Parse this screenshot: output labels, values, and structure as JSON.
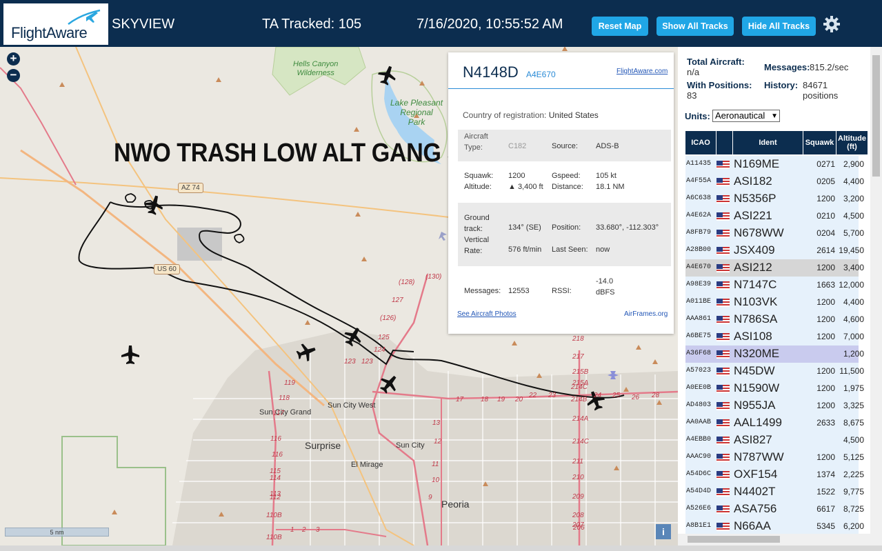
{
  "header": {
    "logo_text": "FlightAware",
    "app_title": "SKYVIEW",
    "tracked": "TA Tracked: 105",
    "datetime": "7/16/2020, 10:55:52 AM",
    "buttons": {
      "reset_map": "Reset Map",
      "show_all_tracks": "Show All Tracks",
      "hide_all_tracks": "Hide All Tracks"
    },
    "icons": {
      "settings": "gear-icon",
      "logo": "plane-logo-icon"
    }
  },
  "map": {
    "zoom_in": "+",
    "zoom_out": "−",
    "overlay_text": "NWO TRASH LOW ALT GANG STALKING",
    "scale_label": "5 nm",
    "info_label": "i",
    "places": {
      "hells_canyon": "Hells Canyon\nWilderness",
      "lake_pleasant": "Lake Pleasant\nRegional\nPark",
      "sun_city_grand": "Sun City Grand",
      "sun_city_west": "Sun City West",
      "surprise": "Surprise",
      "sun_city": "Sun City",
      "el_mirage": "El Mirage",
      "peoria": "Peoria"
    },
    "shields": {
      "az74": "AZ 74",
      "us60": "US 60"
    },
    "route_numbers": [
      "(128)",
      "(130)",
      "127",
      "(126)",
      "125",
      "124",
      "123",
      "123",
      "119",
      "118",
      "117",
      "116",
      "116",
      "115",
      "114",
      "113",
      "112",
      "110B",
      "110B",
      "1",
      "2",
      "3",
      "9",
      "10",
      "11",
      "12",
      "13",
      "17",
      "18",
      "19",
      "20",
      "22",
      "23",
      "24",
      "25",
      "26",
      "28",
      "218",
      "217",
      "215B",
      "215A",
      "214C",
      "214B",
      "214A",
      "214C",
      "211",
      "210",
      "209",
      "208",
      "207",
      "206"
    ]
  },
  "popup": {
    "callsign": "N4148D",
    "hex": "A4E670",
    "link": "FlightAware.com",
    "country_label": "Country of registration:",
    "country": "United States",
    "aircraft_type_label": "Aircraft\nType:",
    "aircraft_type_value": "C182",
    "source_label": "Source:",
    "source": "ADS-B",
    "squawk_label": "Squawk:",
    "squawk": "1200",
    "altitude_label": "Altitude:",
    "altitude": "▲ 3,400 ft",
    "gspeed_label": "Gspeed:",
    "gspeed": "105 kt",
    "distance_label": "Distance:",
    "distance": "18.1 NM",
    "ground_track_label": "Ground\ntrack:",
    "ground_track": "134° (SE)",
    "position_label": "Position:",
    "position": "33.680°, -112.303°",
    "vertical_rate_label": "Vertical\nRate:",
    "vertical_rate": "576 ft/min",
    "last_seen_label": "Last Seen:",
    "last_seen": "now",
    "messages_label": "Messages:",
    "messages": "12553",
    "rssi_label": "RSSI:",
    "rssi": "-14.0\ndBFS",
    "photos_link": "See Aircraft Photos",
    "airframes_link": "AirFrames.org"
  },
  "sidebar": {
    "total_aircraft_label": "Total Aircraft:",
    "total_aircraft": "n/a",
    "messages_label": "Messages:",
    "messages": "815.2/sec",
    "with_positions_label": "With Positions:",
    "with_positions": "83",
    "history_label": "History:",
    "history": "84671\npositions",
    "units_label": "Units:",
    "units_value": "Aeronautical",
    "columns": {
      "icao": "ICAO",
      "flag": "",
      "ident": "Ident",
      "squawk": "Squawk",
      "altitude": "Altitude\n(ft)"
    },
    "rows": [
      {
        "icao": "A11435",
        "ident": "N169ME",
        "squawk": "0271",
        "alt": "2,900",
        "bg": "#e6f1fb"
      },
      {
        "icao": "A4F55A",
        "ident": "ASI182",
        "squawk": "0205",
        "alt": "4,400",
        "bg": "#e6f1fb"
      },
      {
        "icao": "A6C638",
        "ident": "N5356P",
        "squawk": "1200",
        "alt": "3,200",
        "bg": "#e6f1fb"
      },
      {
        "icao": "A4E62A",
        "ident": "ASI221",
        "squawk": "0210",
        "alt": "4,500",
        "bg": "#e6f1fb"
      },
      {
        "icao": "A8FB79",
        "ident": "N678WW",
        "squawk": "0204",
        "alt": "5,700",
        "bg": "#e6f1fb"
      },
      {
        "icao": "A28B00",
        "ident": "JSX409",
        "squawk": "2614",
        "alt": "19,450",
        "bg": "#e6f1fb"
      },
      {
        "icao": "A4E670",
        "ident": "ASI212",
        "squawk": "1200",
        "alt": "3,400",
        "bg": "#d6d6d6"
      },
      {
        "icao": "A98E39",
        "ident": "N7147C",
        "squawk": "1663",
        "alt": "12,000",
        "bg": "#e6f1fb"
      },
      {
        "icao": "A011BE",
        "ident": "N103VK",
        "squawk": "1200",
        "alt": "4,400",
        "bg": "#e6f1fb"
      },
      {
        "icao": "AAA861",
        "ident": "N786SA",
        "squawk": "1200",
        "alt": "4,600",
        "bg": "#e6f1fb"
      },
      {
        "icao": "A6BE75",
        "ident": "ASI108",
        "squawk": "1200",
        "alt": "7,000",
        "bg": "#e6f1fb"
      },
      {
        "icao": "A36F68",
        "ident": "N320ME",
        "squawk": "",
        "alt": "1,200",
        "bg": "#c9cbee"
      },
      {
        "icao": "A57023",
        "ident": "N45DW",
        "squawk": "1200",
        "alt": "11,500",
        "bg": "#e6f1fb"
      },
      {
        "icao": "A0EE0B",
        "ident": "N1590W",
        "squawk": "1200",
        "alt": "1,975",
        "bg": "#e6f1fb"
      },
      {
        "icao": "AD4803",
        "ident": "N955JA",
        "squawk": "1200",
        "alt": "3,325",
        "bg": "#e6f1fb"
      },
      {
        "icao": "AA0AAB",
        "ident": "AAL1499",
        "squawk": "2633",
        "alt": "8,675",
        "bg": "#e6f1fb"
      },
      {
        "icao": "A4EBB0",
        "ident": "ASI827",
        "squawk": "",
        "alt": "4,500",
        "bg": "#e6f1fb"
      },
      {
        "icao": "AAAC90",
        "ident": "N787WW",
        "squawk": "1200",
        "alt": "5,125",
        "bg": "#e6f1fb"
      },
      {
        "icao": "A54D6C",
        "ident": "OXF154",
        "squawk": "1374",
        "alt": "2,225",
        "bg": "#e6f1fb"
      },
      {
        "icao": "A54D4D",
        "ident": "N4402T",
        "squawk": "1522",
        "alt": "9,775",
        "bg": "#e6f1fb"
      },
      {
        "icao": "A526E6",
        "ident": "ASA756",
        "squawk": "6617",
        "alt": "8,725",
        "bg": "#e6f1fb"
      },
      {
        "icao": "A8B1E1",
        "ident": "N66AA",
        "squawk": "5345",
        "alt": "6,200",
        "bg": "#e6f1fb"
      }
    ]
  },
  "colors": {
    "header_bg": "#0c2d4f",
    "button": "#20a6e6",
    "map_bg": "#ebe8e1",
    "selected_row": "#d6d6d6",
    "highlight_row": "#c9cbee"
  }
}
